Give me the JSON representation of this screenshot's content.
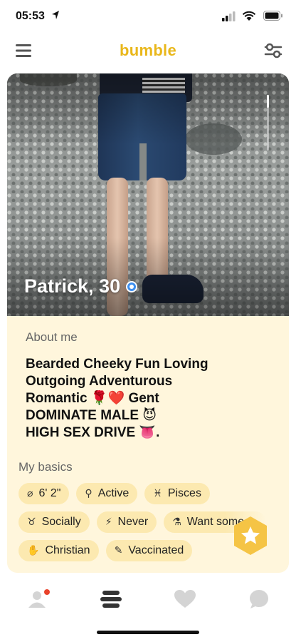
{
  "status_bar": {
    "time": "05:53"
  },
  "header": {
    "brand": "bumble"
  },
  "profile": {
    "name_age": "Patrick, 30",
    "about_label": "About me",
    "bio": "Bearded Cheeky Fun Loving\nOutgoing Adventurous\nRomantic 🌹❤️ Gent\nDOMINATE MALE 😈\nHIGH SEX DRIVE 👅.",
    "basics_label": "My basics",
    "basics": [
      {
        "icon": "ruler-icon",
        "glyph": "⌀",
        "label": "6' 2\""
      },
      {
        "icon": "dumbbell-icon",
        "glyph": "⚲",
        "label": "Active"
      },
      {
        "icon": "zodiac-icon",
        "glyph": "♓",
        "label": "Pisces"
      },
      {
        "icon": "wine-glass-icon",
        "glyph": "♉",
        "label": "Socially"
      },
      {
        "icon": "cigarette-icon",
        "glyph": "⚡",
        "label": "Never"
      },
      {
        "icon": "baby-bottle-icon",
        "glyph": "⚗",
        "label": "Want some"
      },
      {
        "icon": "hands-icon",
        "glyph": "✋",
        "label": "Christian"
      },
      {
        "icon": "syringe-icon",
        "glyph": "✎",
        "label": "Vaccinated"
      }
    ]
  },
  "colors": {
    "brand": "#e9b71a",
    "card_bg": "#fff6dc",
    "chip_bg": "#fce9b0",
    "superswipe": "#f5c445",
    "verified": "#3d8ff0",
    "notification": "#e9432b"
  },
  "nav": [
    {
      "icon": "profile-icon"
    },
    {
      "icon": "people-stack-icon"
    },
    {
      "icon": "heart-icon"
    },
    {
      "icon": "chat-icon"
    }
  ]
}
